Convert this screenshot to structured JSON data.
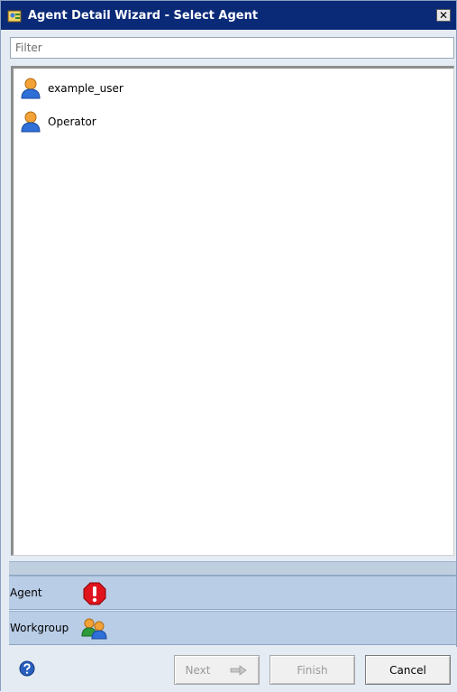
{
  "window": {
    "title": "Agent Detail Wizard - Select Agent",
    "close_glyph": "✕"
  },
  "filter": {
    "placeholder": "Filter",
    "value": ""
  },
  "agents": [
    {
      "name": "example_user",
      "icon": "user-icon"
    },
    {
      "name": "Operator",
      "icon": "user-icon"
    }
  ],
  "steps": [
    {
      "label": "Agent",
      "icon": "error-icon",
      "status": "error"
    },
    {
      "label": "Workgroup",
      "icon": "workgroup-icon",
      "status": "pending"
    }
  ],
  "buttons": {
    "next": "Next",
    "finish": "Finish",
    "cancel": "Cancel"
  },
  "colors": {
    "titlebar": "#0a2a78",
    "error": "#e0141c",
    "step_background": "#b9cde6"
  }
}
